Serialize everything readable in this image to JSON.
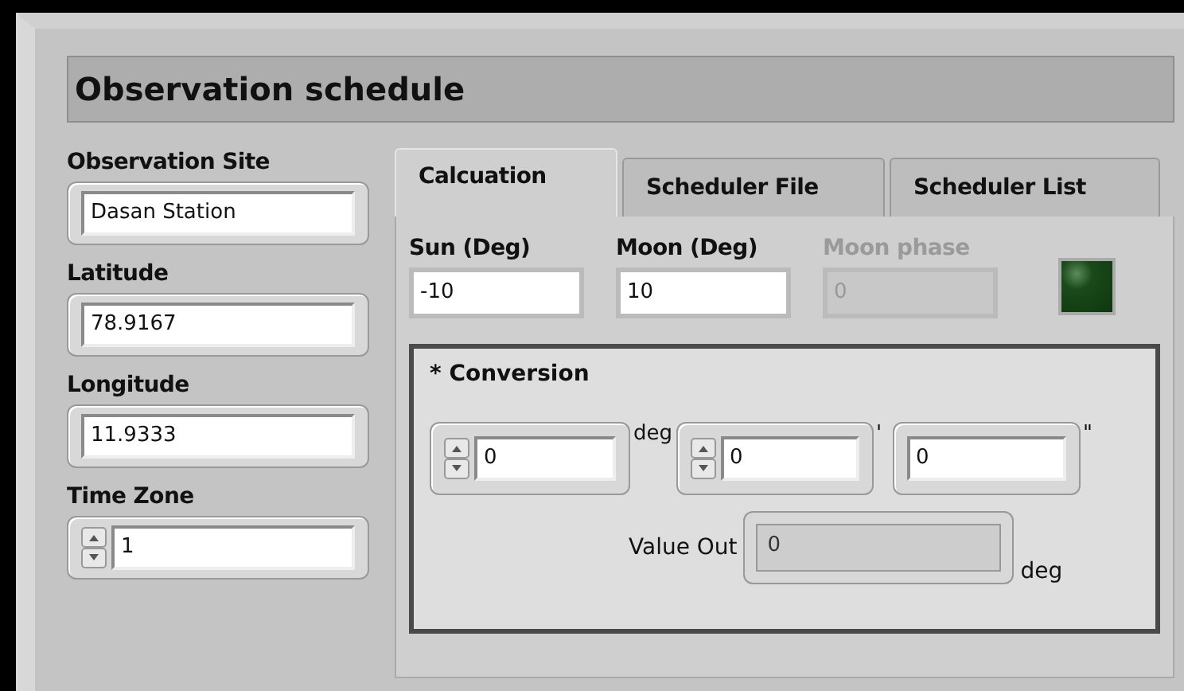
{
  "window": {
    "title": "Observation schedule"
  },
  "site_fields": [
    {
      "label": "Observation Site",
      "value": "Dasan Station",
      "kind": "text"
    },
    {
      "label": "Latitude",
      "value": "78.9167",
      "kind": "text"
    },
    {
      "label": "Longitude",
      "value": "11.9333",
      "kind": "text"
    },
    {
      "label": "Time Zone",
      "value": "1",
      "kind": "numeric"
    }
  ],
  "tabs": [
    {
      "label": "Calcuation",
      "selected": true
    },
    {
      "label": "Scheduler File",
      "selected": false
    },
    {
      "label": "Scheduler List",
      "selected": false
    }
  ],
  "limits": [
    {
      "label": "Sun (Deg)",
      "value": "-10",
      "disabled": false
    },
    {
      "label": "Moon (Deg)",
      "value": "10",
      "disabled": false
    },
    {
      "label": "Moon phase",
      "value": "0",
      "disabled": true
    }
  ],
  "indicator_led": {
    "on": false
  },
  "conversion": {
    "title": "* Conversion",
    "inputs": [
      {
        "value": "0",
        "unit": "deg",
        "kind": "numeric"
      },
      {
        "value": "0",
        "unit": "'",
        "kind": "numeric"
      },
      {
        "value": "0",
        "unit": "\"",
        "kind": "text"
      }
    ],
    "output": {
      "label": "Value Out",
      "value": "0",
      "unit": "deg"
    }
  }
}
